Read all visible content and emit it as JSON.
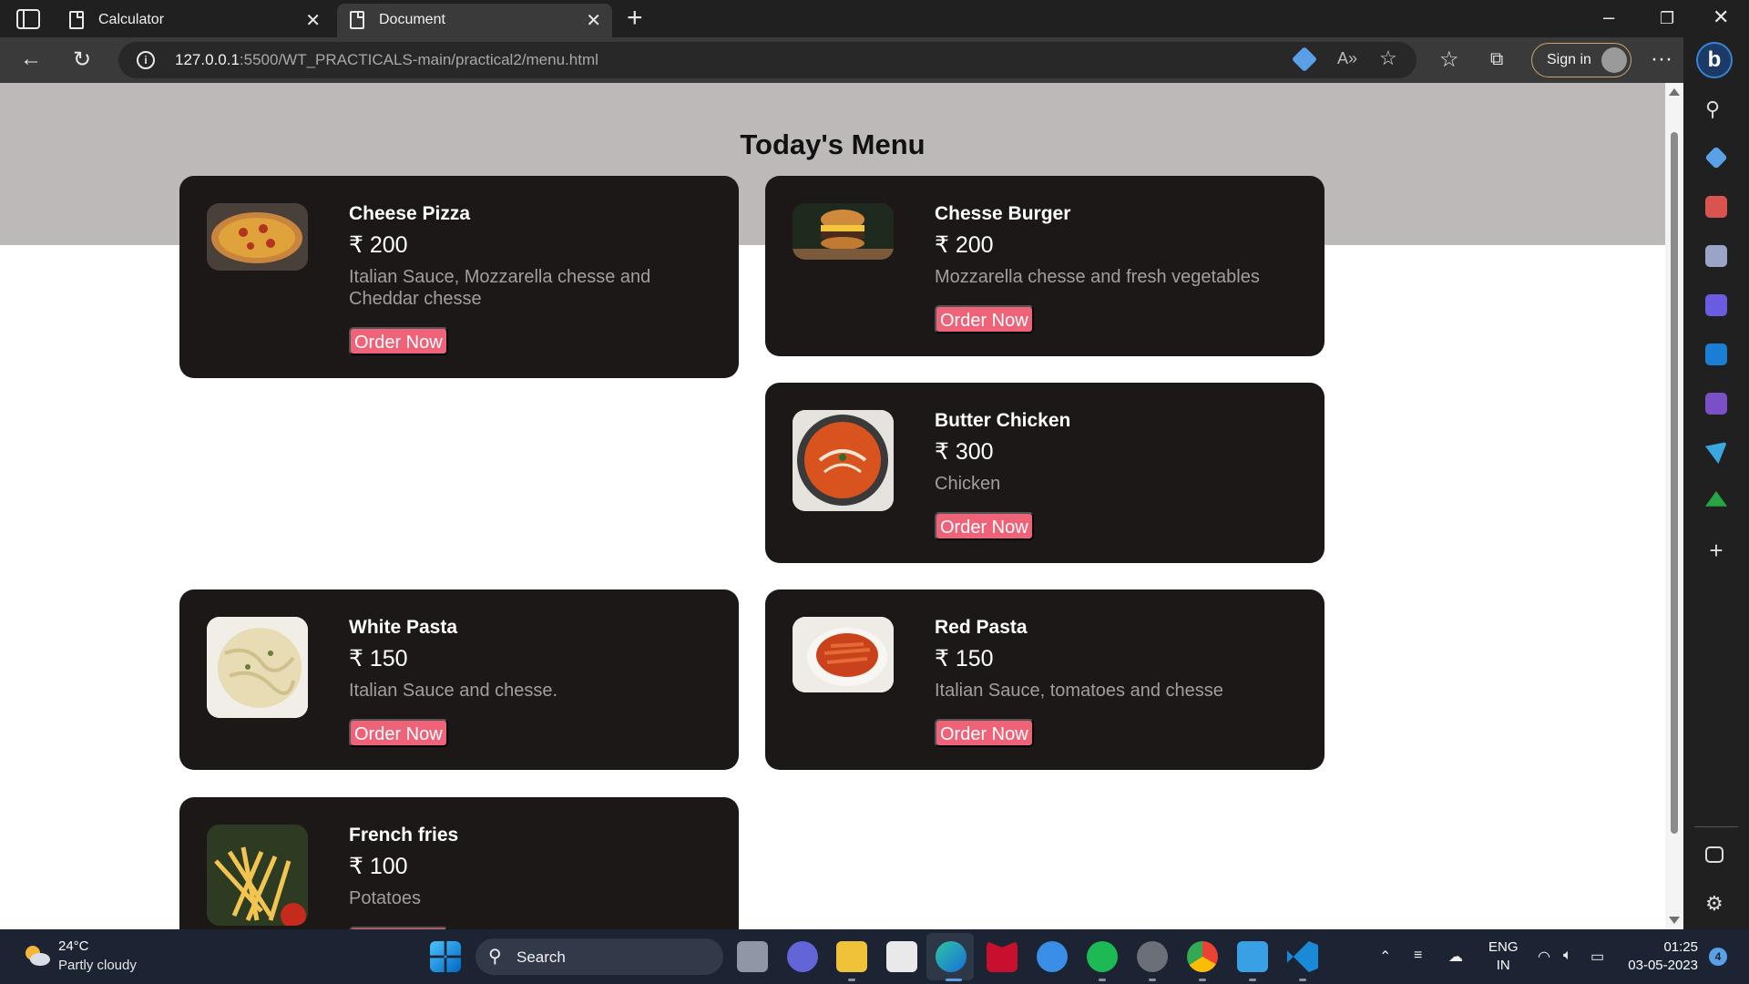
{
  "browser": {
    "tabs": [
      {
        "title": "Calculator",
        "active": false
      },
      {
        "title": "Document",
        "active": true
      }
    ],
    "address": {
      "host": "127.0.0.1",
      "rest": ":5500/WT_PRACTICALS-main/practical2/menu.html"
    },
    "signin_label": "Sign in"
  },
  "page": {
    "title": "Today's Menu",
    "currency": "₹",
    "order_label": "Order Now",
    "items": [
      {
        "name": "Cheese Pizza",
        "price": "₹ 200",
        "desc": "Italian Sauce, Mozzarella chesse and Cheddar chesse",
        "image": "pizza"
      },
      {
        "name": "Chesse Burger",
        "price": "₹ 200",
        "desc": "Mozzarella chesse and fresh vegetables",
        "image": "burger"
      },
      {
        "name": "Butter Chicken",
        "price": "₹ 300",
        "desc": "Chicken",
        "image": "butter-chicken"
      },
      {
        "name": "White Pasta",
        "price": "₹ 150",
        "desc": "Italian Sauce and chesse.",
        "image": "white-pasta"
      },
      {
        "name": "Red Pasta",
        "price": "₹ 150",
        "desc": "Italian Sauce, tomatoes and chesse",
        "image": "red-pasta"
      },
      {
        "name": "French fries",
        "price": "₹ 100",
        "desc": "Potatoes",
        "image": "fries"
      }
    ]
  },
  "taskbar": {
    "weather_temp": "24°C",
    "weather_desc": "Partly cloudy",
    "search_label": "Search",
    "lang_top": "ENG",
    "lang_bottom": "IN",
    "time": "01:25",
    "date": "03-05-2023",
    "notification_count": "4"
  },
  "colors": {
    "card_bg": "#1d1818",
    "order_button": "#ef6379",
    "hero_band": "#bdb9b8",
    "desc_text": "#a29e9e"
  }
}
